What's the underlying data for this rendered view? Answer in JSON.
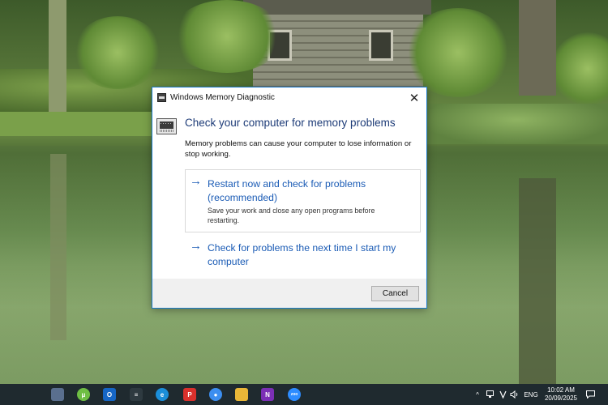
{
  "dialog": {
    "title": "Windows Memory Diagnostic",
    "close_glyph": "✕",
    "heading": "Check your computer for memory problems",
    "description": "Memory problems can cause your computer to lose information or stop working.",
    "options": [
      {
        "title": "Restart now and check for problems (recommended)",
        "subtitle": "Save your work and close any open programs before restarting."
      },
      {
        "title": "Check for problems the next time I start my computer"
      }
    ],
    "arrow_glyph": "→",
    "cancel_label": "Cancel"
  },
  "taskbar": {
    "apps": [
      {
        "name": "calculator-icon",
        "color": "#5a6f8e",
        "glyph": ""
      },
      {
        "name": "utorrent-icon",
        "color": "#6fbe44",
        "glyph": "μ"
      },
      {
        "name": "outlook-icon",
        "color": "#1666c5",
        "glyph": "O"
      },
      {
        "name": "settings-sliders-icon",
        "color": "#2e3a40",
        "glyph": "≡"
      },
      {
        "name": "edge-icon",
        "color": "#1b8ed9",
        "glyph": "e"
      },
      {
        "name": "pdf-reader-icon",
        "color": "#d9302c",
        "glyph": "P"
      },
      {
        "name": "chrome-icon",
        "color": "#3c8ef0",
        "glyph": "●"
      },
      {
        "name": "file-explorer-icon",
        "color": "#e9b638",
        "glyph": ""
      },
      {
        "name": "onenote-icon",
        "color": "#7b2fb5",
        "glyph": "N"
      },
      {
        "name": "zoom-icon",
        "color": "#2d8cff",
        "glyph": "zoo"
      }
    ],
    "tray": {
      "chevron": "^",
      "language": "ENG",
      "time": "10:02 AM",
      "date": "20/09/2025"
    }
  }
}
